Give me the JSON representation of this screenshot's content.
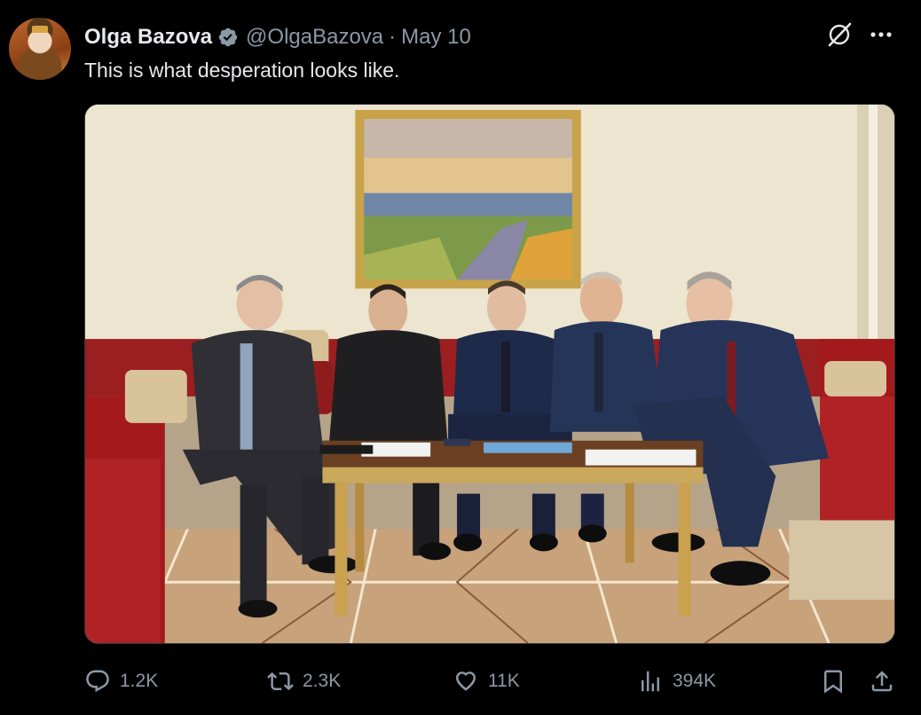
{
  "author": {
    "display_name": "Olga Bazova",
    "handle": "@OlgaBazova",
    "separator": "·",
    "date": "May 10",
    "verified": true,
    "avatar_icon": "avatar-portrait"
  },
  "post": {
    "text": "This is what desperation looks like."
  },
  "top_icons": [
    "grok-icon",
    "more-icon"
  ],
  "actions": {
    "replies": "1.2K",
    "reposts": "2.3K",
    "likes": "11K",
    "views": "394K"
  },
  "colors": {
    "background": "#000000",
    "primary_text": "#e7e9ea",
    "secondary_text": "#8b98a5",
    "verified_badge": "#8b98a5"
  }
}
